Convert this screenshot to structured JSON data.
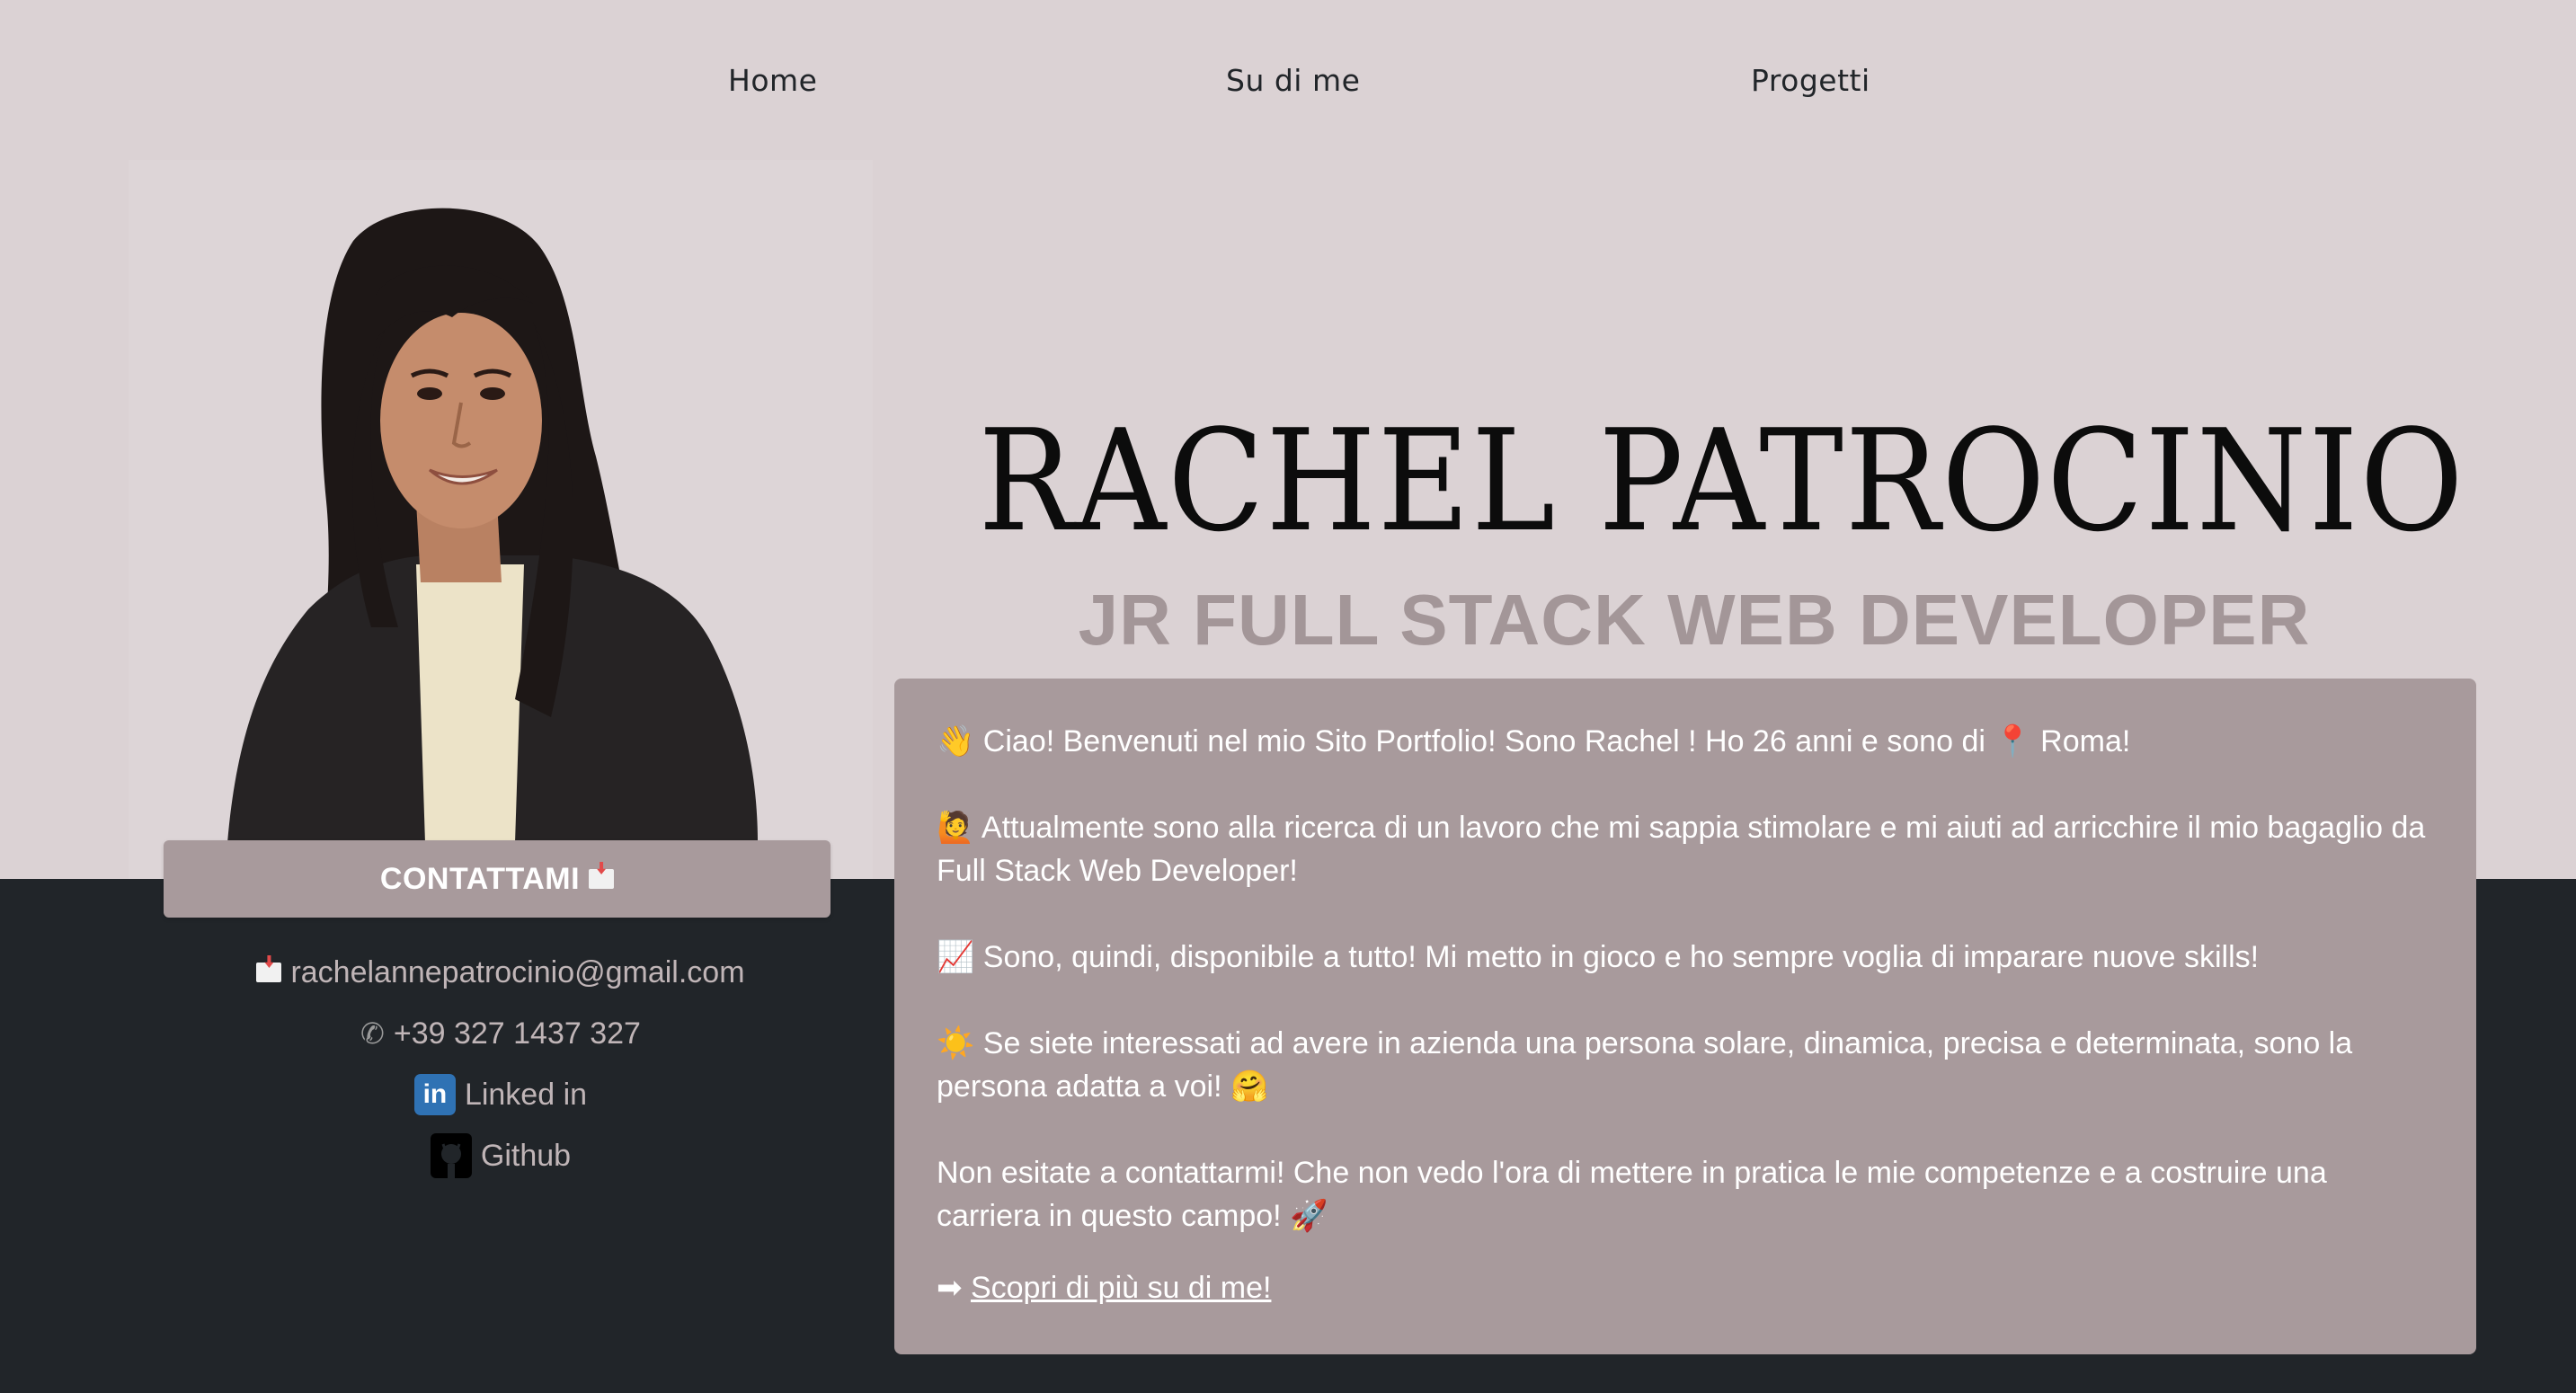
{
  "nav": {
    "home": "Home",
    "about": "Su di me",
    "projects": "Progetti"
  },
  "profile": {
    "name": "RACHEL PATROCINIO",
    "role": "JR FULL STACK WEB DEVELOPER"
  },
  "contact": {
    "button_label": "CONTATTAMI",
    "email": "rachelannepatrocinio@gmail.com",
    "phone": "+39 327 1437 327",
    "linkedin_label": "Linked in",
    "github_label": "Github"
  },
  "about": {
    "p1_emoji": "👋",
    "p1_a": "Ciao! Benvenuti nel mio Sito Portfolio! Sono Rachel ! Ho 26 anni e sono di",
    "p1_pin": "📍",
    "p1_b": "Roma!",
    "p2_emoji": "🙋",
    "p2": "Attualmente sono alla ricerca di un lavoro che mi sappia stimolare e mi aiuti ad arricchire il mio bagaglio da Full Stack Web Developer!",
    "p3_emoji": "📈",
    "p3": "Sono, quindi, disponibile a tutto! Mi metto in gioco e ho sempre voglia di imparare nuove skills!",
    "p4_emoji": "☀️",
    "p4": "Se siete interessati ad avere in azienda una persona solare, dinamica, precisa e determinata, sono la persona adatta a voi!",
    "p4_end": "🤗",
    "p5": "Non esitate a contattarmi! Che non vedo l'ora di mettere in pratica le mie competenze e a costruire una carriera in questo campo!",
    "p5_end": "🚀",
    "more_arrow": "➡",
    "more_link": "Scopri di più su di me!"
  },
  "colors": {
    "top_band": "#dbd2d4",
    "bottom_band": "#212529",
    "card": "#a89a9c",
    "role_text": "#a39698"
  },
  "icons": {
    "email": "envelope-icon",
    "phone": "phone-icon",
    "linkedin": "linkedin-icon",
    "github": "github-icon"
  }
}
